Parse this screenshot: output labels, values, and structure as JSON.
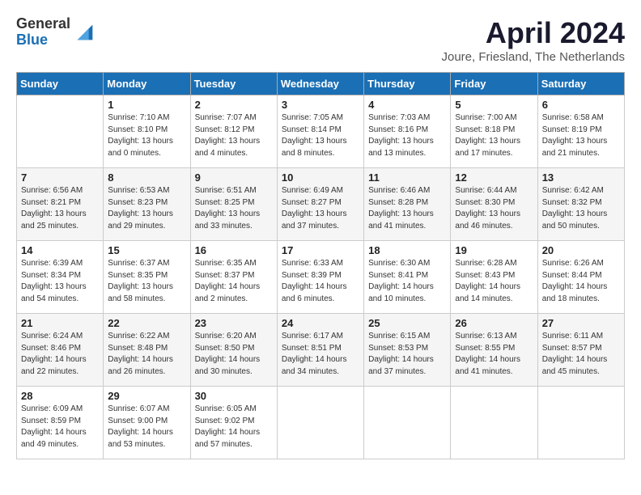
{
  "header": {
    "logo_general": "General",
    "logo_blue": "Blue",
    "month_title": "April 2024",
    "location": "Joure, Friesland, The Netherlands"
  },
  "weekdays": [
    "Sunday",
    "Monday",
    "Tuesday",
    "Wednesday",
    "Thursday",
    "Friday",
    "Saturday"
  ],
  "weeks": [
    [
      {
        "day": "",
        "sunrise": "",
        "sunset": "",
        "daylight": ""
      },
      {
        "day": "1",
        "sunrise": "Sunrise: 7:10 AM",
        "sunset": "Sunset: 8:10 PM",
        "daylight": "Daylight: 13 hours and 0 minutes."
      },
      {
        "day": "2",
        "sunrise": "Sunrise: 7:07 AM",
        "sunset": "Sunset: 8:12 PM",
        "daylight": "Daylight: 13 hours and 4 minutes."
      },
      {
        "day": "3",
        "sunrise": "Sunrise: 7:05 AM",
        "sunset": "Sunset: 8:14 PM",
        "daylight": "Daylight: 13 hours and 8 minutes."
      },
      {
        "day": "4",
        "sunrise": "Sunrise: 7:03 AM",
        "sunset": "Sunset: 8:16 PM",
        "daylight": "Daylight: 13 hours and 13 minutes."
      },
      {
        "day": "5",
        "sunrise": "Sunrise: 7:00 AM",
        "sunset": "Sunset: 8:18 PM",
        "daylight": "Daylight: 13 hours and 17 minutes."
      },
      {
        "day": "6",
        "sunrise": "Sunrise: 6:58 AM",
        "sunset": "Sunset: 8:19 PM",
        "daylight": "Daylight: 13 hours and 21 minutes."
      }
    ],
    [
      {
        "day": "7",
        "sunrise": "Sunrise: 6:56 AM",
        "sunset": "Sunset: 8:21 PM",
        "daylight": "Daylight: 13 hours and 25 minutes."
      },
      {
        "day": "8",
        "sunrise": "Sunrise: 6:53 AM",
        "sunset": "Sunset: 8:23 PM",
        "daylight": "Daylight: 13 hours and 29 minutes."
      },
      {
        "day": "9",
        "sunrise": "Sunrise: 6:51 AM",
        "sunset": "Sunset: 8:25 PM",
        "daylight": "Daylight: 13 hours and 33 minutes."
      },
      {
        "day": "10",
        "sunrise": "Sunrise: 6:49 AM",
        "sunset": "Sunset: 8:27 PM",
        "daylight": "Daylight: 13 hours and 37 minutes."
      },
      {
        "day": "11",
        "sunrise": "Sunrise: 6:46 AM",
        "sunset": "Sunset: 8:28 PM",
        "daylight": "Daylight: 13 hours and 41 minutes."
      },
      {
        "day": "12",
        "sunrise": "Sunrise: 6:44 AM",
        "sunset": "Sunset: 8:30 PM",
        "daylight": "Daylight: 13 hours and 46 minutes."
      },
      {
        "day": "13",
        "sunrise": "Sunrise: 6:42 AM",
        "sunset": "Sunset: 8:32 PM",
        "daylight": "Daylight: 13 hours and 50 minutes."
      }
    ],
    [
      {
        "day": "14",
        "sunrise": "Sunrise: 6:39 AM",
        "sunset": "Sunset: 8:34 PM",
        "daylight": "Daylight: 13 hours and 54 minutes."
      },
      {
        "day": "15",
        "sunrise": "Sunrise: 6:37 AM",
        "sunset": "Sunset: 8:35 PM",
        "daylight": "Daylight: 13 hours and 58 minutes."
      },
      {
        "day": "16",
        "sunrise": "Sunrise: 6:35 AM",
        "sunset": "Sunset: 8:37 PM",
        "daylight": "Daylight: 14 hours and 2 minutes."
      },
      {
        "day": "17",
        "sunrise": "Sunrise: 6:33 AM",
        "sunset": "Sunset: 8:39 PM",
        "daylight": "Daylight: 14 hours and 6 minutes."
      },
      {
        "day": "18",
        "sunrise": "Sunrise: 6:30 AM",
        "sunset": "Sunset: 8:41 PM",
        "daylight": "Daylight: 14 hours and 10 minutes."
      },
      {
        "day": "19",
        "sunrise": "Sunrise: 6:28 AM",
        "sunset": "Sunset: 8:43 PM",
        "daylight": "Daylight: 14 hours and 14 minutes."
      },
      {
        "day": "20",
        "sunrise": "Sunrise: 6:26 AM",
        "sunset": "Sunset: 8:44 PM",
        "daylight": "Daylight: 14 hours and 18 minutes."
      }
    ],
    [
      {
        "day": "21",
        "sunrise": "Sunrise: 6:24 AM",
        "sunset": "Sunset: 8:46 PM",
        "daylight": "Daylight: 14 hours and 22 minutes."
      },
      {
        "day": "22",
        "sunrise": "Sunrise: 6:22 AM",
        "sunset": "Sunset: 8:48 PM",
        "daylight": "Daylight: 14 hours and 26 minutes."
      },
      {
        "day": "23",
        "sunrise": "Sunrise: 6:20 AM",
        "sunset": "Sunset: 8:50 PM",
        "daylight": "Daylight: 14 hours and 30 minutes."
      },
      {
        "day": "24",
        "sunrise": "Sunrise: 6:17 AM",
        "sunset": "Sunset: 8:51 PM",
        "daylight": "Daylight: 14 hours and 34 minutes."
      },
      {
        "day": "25",
        "sunrise": "Sunrise: 6:15 AM",
        "sunset": "Sunset: 8:53 PM",
        "daylight": "Daylight: 14 hours and 37 minutes."
      },
      {
        "day": "26",
        "sunrise": "Sunrise: 6:13 AM",
        "sunset": "Sunset: 8:55 PM",
        "daylight": "Daylight: 14 hours and 41 minutes."
      },
      {
        "day": "27",
        "sunrise": "Sunrise: 6:11 AM",
        "sunset": "Sunset: 8:57 PM",
        "daylight": "Daylight: 14 hours and 45 minutes."
      }
    ],
    [
      {
        "day": "28",
        "sunrise": "Sunrise: 6:09 AM",
        "sunset": "Sunset: 8:59 PM",
        "daylight": "Daylight: 14 hours and 49 minutes."
      },
      {
        "day": "29",
        "sunrise": "Sunrise: 6:07 AM",
        "sunset": "Sunset: 9:00 PM",
        "daylight": "Daylight: 14 hours and 53 minutes."
      },
      {
        "day": "30",
        "sunrise": "Sunrise: 6:05 AM",
        "sunset": "Sunset: 9:02 PM",
        "daylight": "Daylight: 14 hours and 57 minutes."
      },
      {
        "day": "",
        "sunrise": "",
        "sunset": "",
        "daylight": ""
      },
      {
        "day": "",
        "sunrise": "",
        "sunset": "",
        "daylight": ""
      },
      {
        "day": "",
        "sunrise": "",
        "sunset": "",
        "daylight": ""
      },
      {
        "day": "",
        "sunrise": "",
        "sunset": "",
        "daylight": ""
      }
    ]
  ]
}
